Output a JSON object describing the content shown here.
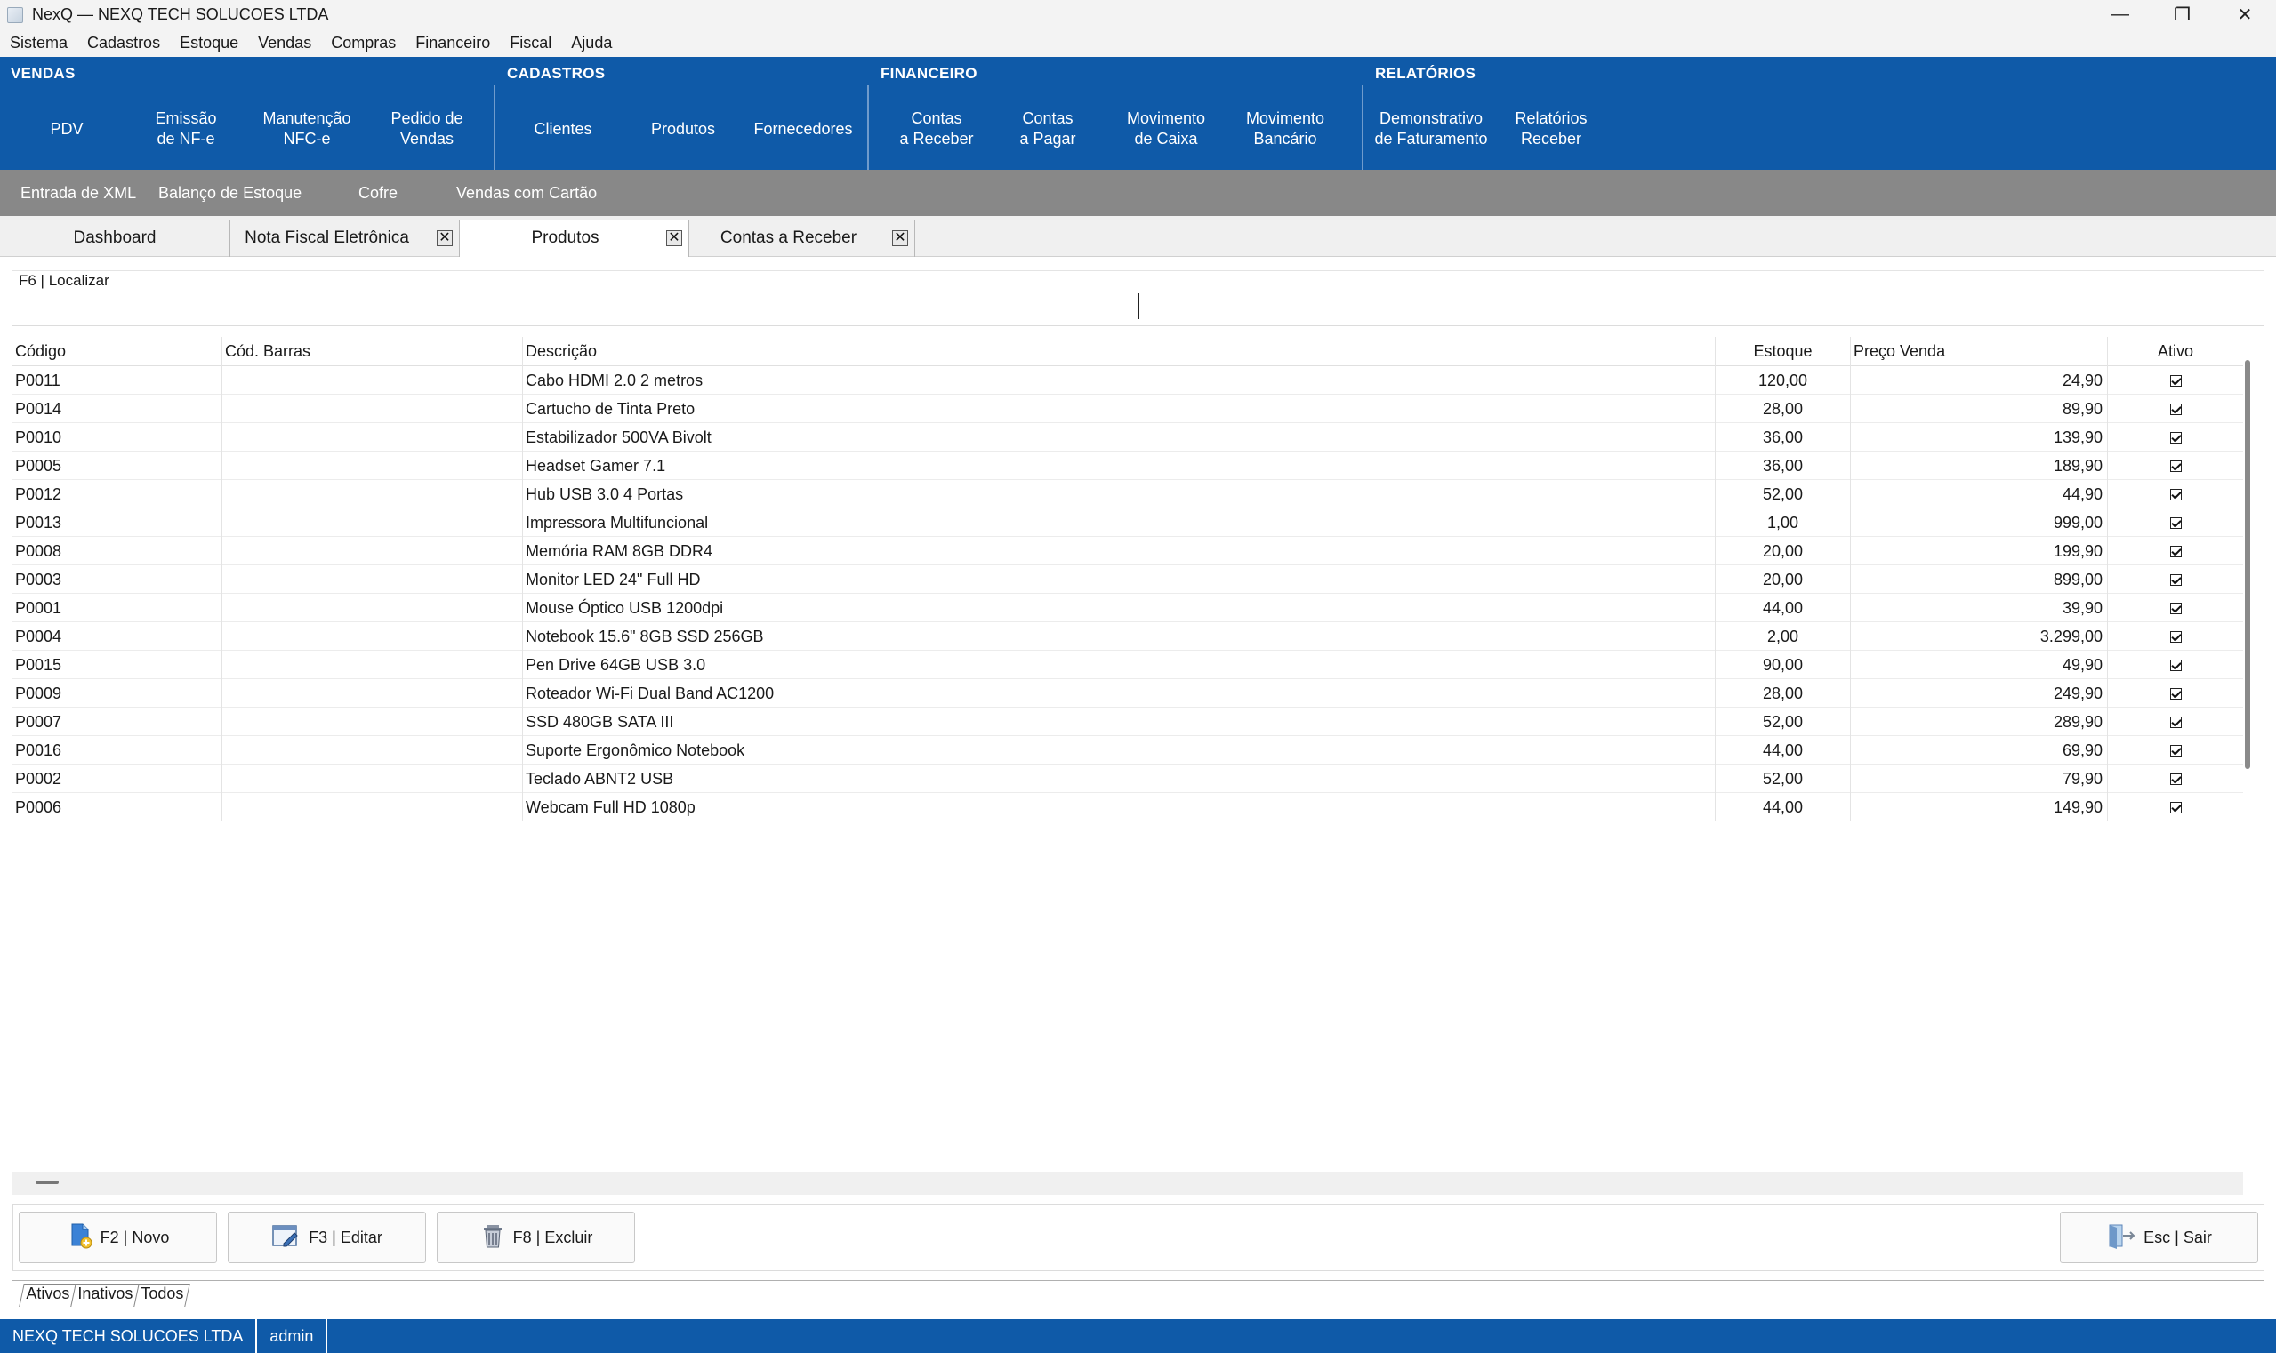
{
  "window": {
    "title": "NexQ — NEXQ TECH SOLUCOES LTDA",
    "controls": {
      "minimize": "—",
      "restore": "❐",
      "close": "✕"
    }
  },
  "menu": [
    "Sistema",
    "Cadastros",
    "Estoque",
    "Vendas",
    "Compras",
    "Financeiro",
    "Fiscal",
    "Ajuda"
  ],
  "ribbon": {
    "vendas": {
      "title": "VENDAS",
      "buttons": [
        "PDV",
        "Emissão\nde NF-e",
        "Manutenção\nNFC-e",
        "Pedido de\nVendas"
      ]
    },
    "cadastros": {
      "title": "CADASTROS",
      "buttons": [
        "Clientes",
        "Produtos",
        "Fornecedores"
      ]
    },
    "financeiro": {
      "title": "FINANCEIRO",
      "buttons": [
        "Contas\na Receber",
        "Contas\na Pagar",
        "Movimento\nde Caixa",
        "Movimento\nBancário"
      ]
    },
    "relatorios": {
      "title": "RELATÓRIOS",
      "buttons": [
        "Demonstrativo\nde Faturamento",
        "Relatórios\nReceber"
      ]
    }
  },
  "subbar": [
    "Entrada de XML",
    "Balanço de Estoque",
    "Cofre",
    "Vendas com Cartão"
  ],
  "tabs": [
    {
      "label": "Dashboard",
      "closable": false
    },
    {
      "label": "Nota Fiscal Eletrônica",
      "closable": true
    },
    {
      "label": "Produtos",
      "closable": true,
      "active": true
    },
    {
      "label": "Contas a Receber",
      "closable": true
    }
  ],
  "search": {
    "label": "F6 | Localizar",
    "value": ""
  },
  "grid": {
    "headers": {
      "codigo": "Código",
      "barras": "Cód. Barras",
      "descricao": "Descrição",
      "estoque": "Estoque",
      "preco": "Preço Venda",
      "ativo": "Ativo"
    },
    "rows": [
      {
        "codigo": "P0011",
        "barras": "",
        "descricao": "Cabo HDMI 2.0 2 metros",
        "estoque": "120,00",
        "preco": "24,90",
        "ativo": true
      },
      {
        "codigo": "P0014",
        "barras": "",
        "descricao": "Cartucho de Tinta Preto",
        "estoque": "28,00",
        "preco": "89,90",
        "ativo": true
      },
      {
        "codigo": "P0010",
        "barras": "",
        "descricao": "Estabilizador 500VA Bivolt",
        "estoque": "36,00",
        "preco": "139,90",
        "ativo": true
      },
      {
        "codigo": "P0005",
        "barras": "",
        "descricao": "Headset Gamer 7.1",
        "estoque": "36,00",
        "preco": "189,90",
        "ativo": true
      },
      {
        "codigo": "P0012",
        "barras": "",
        "descricao": "Hub USB 3.0 4 Portas",
        "estoque": "52,00",
        "preco": "44,90",
        "ativo": true
      },
      {
        "codigo": "P0013",
        "barras": "",
        "descricao": "Impressora Multifuncional",
        "estoque": "1,00",
        "preco": "999,00",
        "ativo": true
      },
      {
        "codigo": "P0008",
        "barras": "",
        "descricao": "Memória RAM 8GB DDR4",
        "estoque": "20,00",
        "preco": "199,90",
        "ativo": true
      },
      {
        "codigo": "P0003",
        "barras": "",
        "descricao": "Monitor LED 24\" Full HD",
        "estoque": "20,00",
        "preco": "899,00",
        "ativo": true
      },
      {
        "codigo": "P0001",
        "barras": "",
        "descricao": "Mouse Óptico USB 1200dpi",
        "estoque": "44,00",
        "preco": "39,90",
        "ativo": true
      },
      {
        "codigo": "P0004",
        "barras": "",
        "descricao": "Notebook 15.6\" 8GB SSD 256GB",
        "estoque": "2,00",
        "preco": "3.299,00",
        "ativo": true
      },
      {
        "codigo": "P0015",
        "barras": "",
        "descricao": "Pen Drive 64GB USB 3.0",
        "estoque": "90,00",
        "preco": "49,90",
        "ativo": true
      },
      {
        "codigo": "P0009",
        "barras": "",
        "descricao": "Roteador Wi-Fi Dual Band AC1200",
        "estoque": "28,00",
        "preco": "249,90",
        "ativo": true
      },
      {
        "codigo": "P0007",
        "barras": "",
        "descricao": "SSD 480GB SATA III",
        "estoque": "52,00",
        "preco": "289,90",
        "ativo": true
      },
      {
        "codigo": "P0016",
        "barras": "",
        "descricao": "Suporte Ergonômico Notebook",
        "estoque": "44,00",
        "preco": "69,90",
        "ativo": true
      },
      {
        "codigo": "P0002",
        "barras": "",
        "descricao": "Teclado ABNT2 USB",
        "estoque": "52,00",
        "preco": "79,90",
        "ativo": true
      },
      {
        "codigo": "P0006",
        "barras": "",
        "descricao": "Webcam Full HD 1080p",
        "estoque": "44,00",
        "preco": "149,90",
        "ativo": true
      }
    ]
  },
  "actions": {
    "novo": "F2 | Novo",
    "editar": "F3 | Editar",
    "excluir": "F8 | Excluir",
    "sair": "Esc | Sair"
  },
  "filter_tabs": [
    "Ativos",
    "Inativos",
    "Todos"
  ],
  "status": {
    "company": "NEXQ TECH SOLUCOES LTDA",
    "user": "admin"
  },
  "colors": {
    "ribbon": "#0f5aa8",
    "subbar": "#888888",
    "status": "#0f5aa8"
  }
}
